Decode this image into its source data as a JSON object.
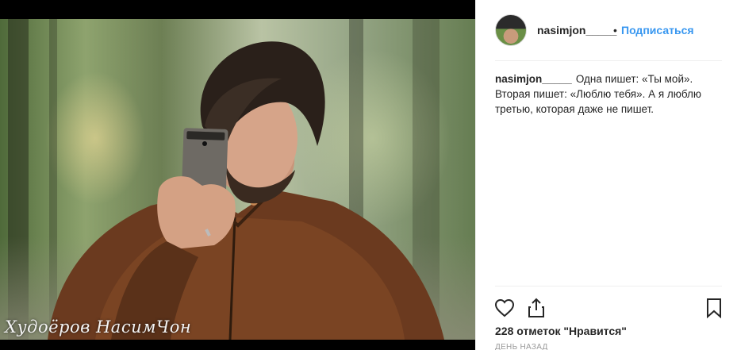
{
  "post": {
    "watermark": "Худоёров НасимЧон"
  },
  "header": {
    "username": "nasimjon_____",
    "separator": "•",
    "follow_label": "Подписаться"
  },
  "caption": {
    "username": "nasimjon_____",
    "text": "Одна пишет: «Ты мой». Вторая пишет: «Люблю тебя». А я люблю третью, которая даже не пишет."
  },
  "actions": {
    "like_icon": "heart-icon",
    "share_icon": "share-icon",
    "save_icon": "bookmark-icon"
  },
  "stats": {
    "likes_text": "228 отметок \"Нравится\"",
    "time_text": "ДЕНЬ НАЗАД"
  },
  "colors": {
    "follow_blue": "#3897f0",
    "text": "#262626",
    "divider": "#efefef"
  }
}
